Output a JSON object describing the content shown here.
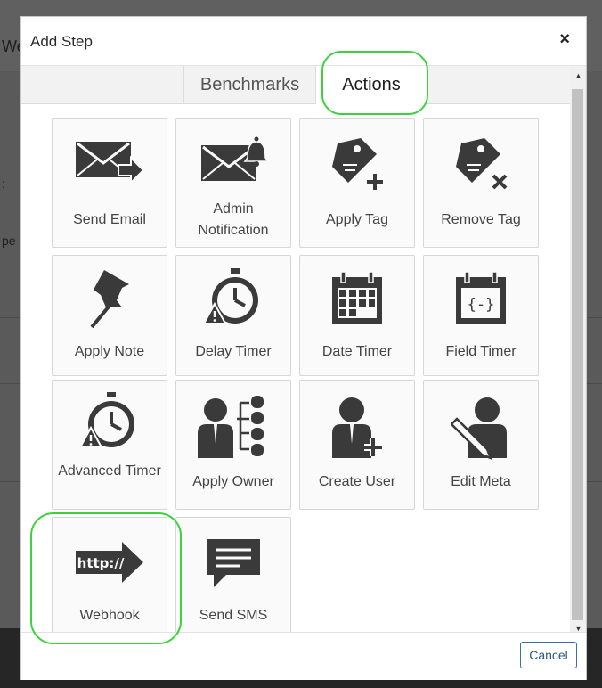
{
  "background": {
    "fragments": [
      "We",
      ":",
      "pe"
    ]
  },
  "dialog": {
    "title": "Add Step",
    "close_glyph": "×",
    "tabs": [
      {
        "label": "Benchmarks",
        "active": false
      },
      {
        "label": "Actions",
        "active": true
      }
    ],
    "tiles": [
      {
        "label": "Send Email",
        "icon": "envelope-arrow-icon"
      },
      {
        "label": "Admin Notification",
        "icon": "envelope-bell-icon"
      },
      {
        "label": "Apply Tag",
        "icon": "tag-plus-icon"
      },
      {
        "label": "Remove Tag",
        "icon": "tag-x-icon"
      },
      {
        "label": "Apply Note",
        "icon": "pushpin-icon"
      },
      {
        "label": "Delay Timer",
        "icon": "stopwatch-warning-icon"
      },
      {
        "label": "Date Timer",
        "icon": "calendar-icon"
      },
      {
        "label": "Field Timer",
        "icon": "calendar-braces-icon"
      },
      {
        "label": "Advanced Timer",
        "icon": "stopwatch-warning-icon"
      },
      {
        "label": "Apply Owner",
        "icon": "person-hierarchy-icon"
      },
      {
        "label": "Create User",
        "icon": "person-plus-icon"
      },
      {
        "label": "Edit Meta",
        "icon": "person-pencil-icon"
      },
      {
        "label": "Webhook",
        "icon": "http-arrow-icon",
        "http_text": "http://"
      },
      {
        "label": "Send SMS",
        "icon": "chat-bubble-icon"
      }
    ],
    "cancel_label": "Cancel"
  },
  "colors": {
    "highlight": "#3dd23d",
    "icon": "#3a3a3a",
    "cancel_border": "#3a6ea5"
  }
}
